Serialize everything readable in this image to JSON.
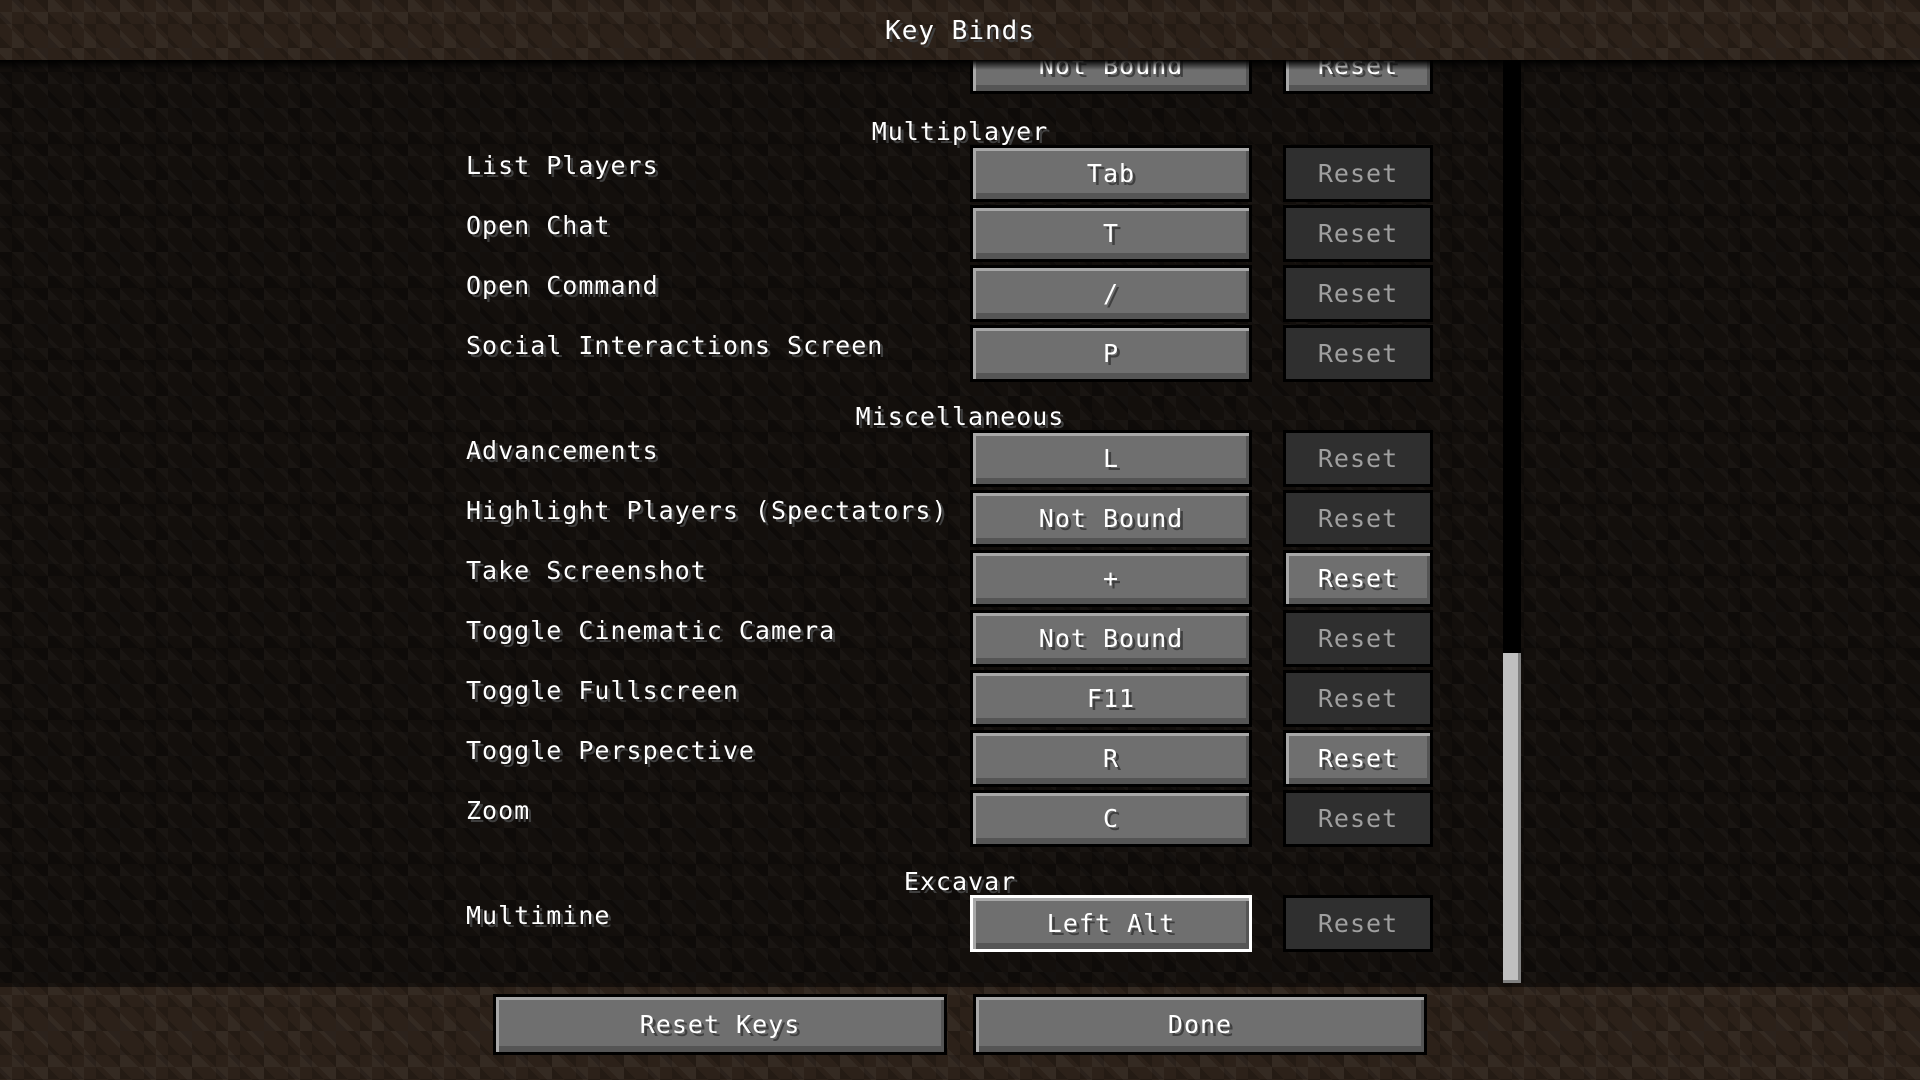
{
  "header": {
    "title": "Key Binds"
  },
  "list": {
    "partial_top_row": {
      "key": "Not Bound",
      "reset": "Reset",
      "reset_enabled": true
    },
    "sections": [
      {
        "title": "Multiplayer",
        "rows": [
          {
            "label": "List Players",
            "key": "Tab",
            "reset": "Reset",
            "reset_enabled": false
          },
          {
            "label": "Open Chat",
            "key": "T",
            "reset": "Reset",
            "reset_enabled": false
          },
          {
            "label": "Open Command",
            "key": "/",
            "reset": "Reset",
            "reset_enabled": false
          },
          {
            "label": "Social Interactions Screen",
            "key": "P",
            "reset": "Reset",
            "reset_enabled": false
          }
        ]
      },
      {
        "title": "Miscellaneous",
        "rows": [
          {
            "label": "Advancements",
            "key": "L",
            "reset": "Reset",
            "reset_enabled": false
          },
          {
            "label": "Highlight Players (Spectators)",
            "key": "Not Bound",
            "reset": "Reset",
            "reset_enabled": false
          },
          {
            "label": "Take Screenshot",
            "key": "+",
            "reset": "Reset",
            "reset_enabled": true
          },
          {
            "label": "Toggle Cinematic Camera",
            "key": "Not Bound",
            "reset": "Reset",
            "reset_enabled": false
          },
          {
            "label": "Toggle Fullscreen",
            "key": "F11",
            "reset": "Reset",
            "reset_enabled": false
          },
          {
            "label": "Toggle Perspective",
            "key": "R",
            "reset": "Reset",
            "reset_enabled": true
          },
          {
            "label": "Zoom",
            "key": "C",
            "reset": "Reset",
            "reset_enabled": false
          }
        ]
      },
      {
        "title": "Excavar",
        "rows": [
          {
            "label": "Multimine",
            "key": "Left Alt",
            "reset": "Reset",
            "reset_enabled": false,
            "focused": true
          }
        ]
      }
    ],
    "scroll": {
      "thumb_start_fraction": 0.643,
      "thumb_size_fraction": 0.357
    }
  },
  "footer": {
    "reset_keys_label": "Reset Keys",
    "done_label": "Done"
  }
}
